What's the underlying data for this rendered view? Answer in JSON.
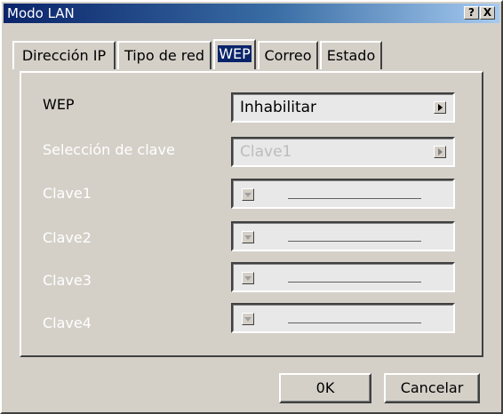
{
  "window": {
    "title": "Modo LAN",
    "help_glyph": "?",
    "close_glyph": "X"
  },
  "tabs": [
    {
      "label": "Dirección IP",
      "active": false
    },
    {
      "label": "Tipo de red",
      "active": false
    },
    {
      "label": "WEP",
      "active": true
    },
    {
      "label": "Correo",
      "active": false
    },
    {
      "label": "Estado",
      "active": false
    }
  ],
  "form": {
    "wep_label": "WEP",
    "wep_value": "Inhabilitar",
    "key_select_label": "Selección de clave",
    "key_select_value": "Clave1",
    "key1_label": "Clave1",
    "key2_label": "Clave2",
    "key3_label": "Clave3",
    "key4_label": "Clave4"
  },
  "buttons": {
    "ok": "0K",
    "cancel": "Cancelar"
  },
  "colors": {
    "face": "#d4d0c8",
    "title_start": "#0a246a",
    "title_end": "#a6caf0"
  }
}
